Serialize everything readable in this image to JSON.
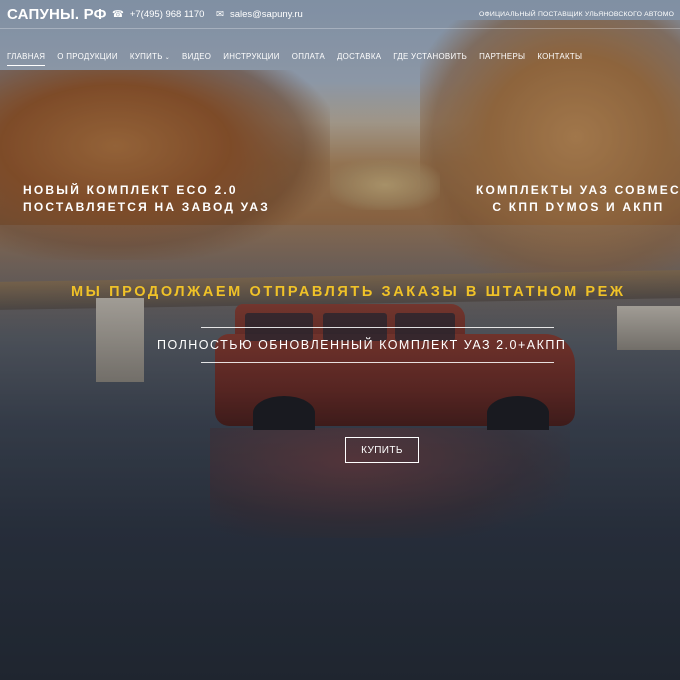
{
  "header": {
    "logo": "САПУНЫ. РФ",
    "phone": "+7(495) 968 1170",
    "phone_icon": "phone-icon",
    "email": "sales@sapuny.ru",
    "email_icon": "envelope-icon",
    "official_text": "ОФИЦИАЛЬНЫЙ ПОСТАВЩИК УЛЬЯНОВСКОГО АВТОМО"
  },
  "nav": {
    "items": [
      {
        "label": "ГЛАВНАЯ",
        "active": true
      },
      {
        "label": "О ПРОДУКЦИИ"
      },
      {
        "label": "КУПИТЬ",
        "has_dropdown": true
      },
      {
        "label": "ВИДЕО"
      },
      {
        "label": "ИНСТРУКЦИИ"
      },
      {
        "label": "ОПЛАТА"
      },
      {
        "label": "ДОСТАВКА"
      },
      {
        "label": "ГДЕ УСТАНОВИТЬ"
      },
      {
        "label": "ПАРТНЕРЫ"
      },
      {
        "label": "КОНТАКТЫ"
      }
    ]
  },
  "hero": {
    "promo_left": [
      "НОВЫЙ КОМПЛЕКТ ECO 2.0",
      "ПОСТАВЛЯЕТСЯ НА ЗАВОД УАЗ"
    ],
    "promo_right": [
      "КОМПЛЕКТЫ УАЗ СОВМЕС",
      "С КПП DYMOS И АКПП"
    ],
    "headline": "МЫ ПРОДОЛЖАЕМ ОТПРАВЛЯТЬ ЗАКАЗЫ В ШТАТНОМ РЕЖ",
    "subtitle": "ПОЛНОСТЬЮ ОБНОВЛЕННЫЙ КОМПЛЕКТ УАЗ 2.0+АКПП",
    "button": "КУПИТЬ"
  },
  "colors": {
    "accent_yellow": "#f0c228",
    "text_white": "#ffffff"
  }
}
